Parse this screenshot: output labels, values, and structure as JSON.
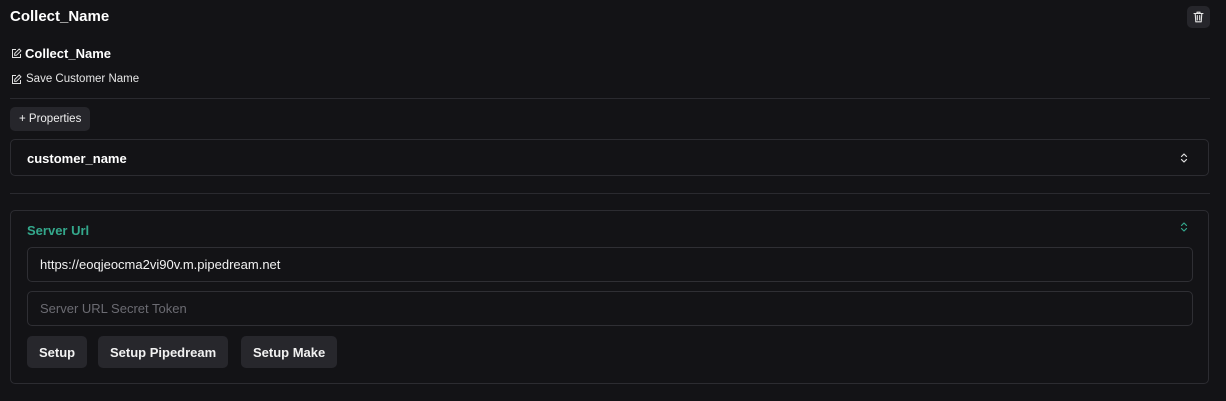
{
  "header": {
    "title": "Collect_Name"
  },
  "node": {
    "name": "Collect_Name",
    "description": "Save Customer Name"
  },
  "properties": {
    "add_label": "+ Properties",
    "items": [
      {
        "label": "customer_name"
      }
    ]
  },
  "server": {
    "title": "Server Url",
    "url_value": "https://eoqjeocma2vi90v.m.pipedream.net",
    "token_placeholder": "Server URL Secret Token",
    "buttons": {
      "setup": "Setup",
      "pipedream": "Setup Pipedream",
      "make": "Setup Make"
    }
  },
  "colors": {
    "background": "#131316",
    "accent": "#34a88c"
  }
}
